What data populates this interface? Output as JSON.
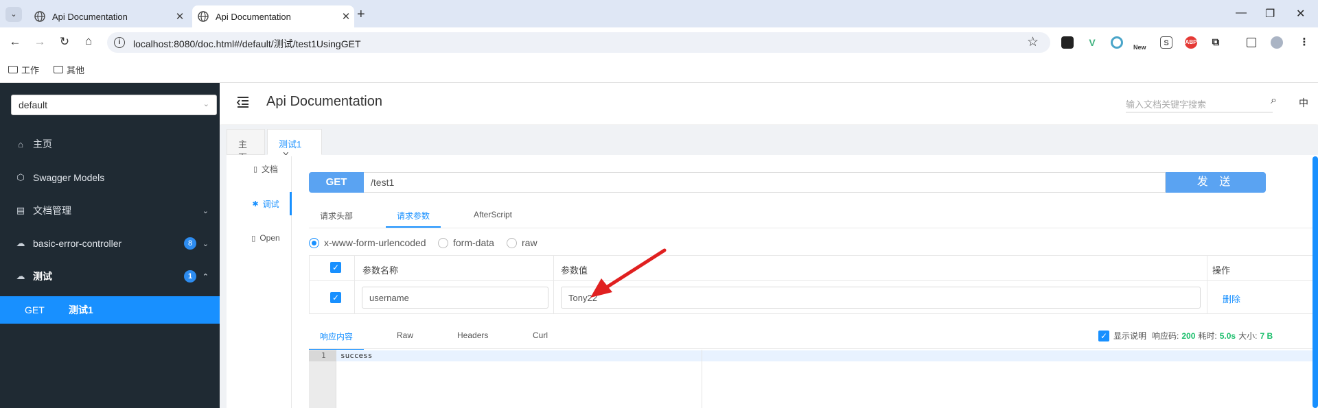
{
  "browser": {
    "tabs": [
      {
        "label": "Api Documentation",
        "active": false
      },
      {
        "label": "Api Documentation",
        "active": true
      }
    ],
    "url": "localhost:8080/doc.html#/default/测试/test1UsingGET",
    "bookmarks": [
      "工作",
      "其他"
    ],
    "extensions": [
      {
        "name": "shopping-bag-icon",
        "text": "",
        "color": "#222222"
      },
      {
        "name": "vue-devtools-icon",
        "text": "V",
        "color": "#3fb27f"
      },
      {
        "name": "circle-extension-icon",
        "text": "",
        "color": "#4aa5c9"
      },
      {
        "name": "new-extension-icon",
        "text": "New",
        "color": "#333333"
      },
      {
        "name": "s-extension-icon",
        "text": "S",
        "color": "#555555"
      },
      {
        "name": "adblock-icon",
        "text": "ABP",
        "color": "#e53935"
      }
    ]
  },
  "sidebar": {
    "group_select": "default",
    "items": [
      {
        "label": "主页",
        "icon": "home-icon"
      },
      {
        "label": "Swagger Models",
        "icon": "cube-icon"
      },
      {
        "label": "文档管理",
        "icon": "doc-manage-icon"
      },
      {
        "label": "basic-error-controller",
        "icon": "cloud-icon",
        "badge": "8"
      },
      {
        "label": "测试",
        "icon": "cloud-icon",
        "badge": "1"
      }
    ],
    "sub_item": {
      "method": "GET",
      "name": "测试1"
    }
  },
  "header": {
    "title": "Api Documentation",
    "search_placeholder": "输入文档关键字搜索",
    "lang": "中"
  },
  "page_tabs": [
    {
      "label": "主页"
    },
    {
      "label": "测试1",
      "close": "X"
    }
  ],
  "side_tabs": [
    {
      "label": "文档"
    },
    {
      "label": "调试"
    },
    {
      "label": "Open"
    }
  ],
  "request": {
    "method": "GET",
    "path": "/test1",
    "send_label": "发 送"
  },
  "request_tabs": [
    "请求头部",
    "请求参数",
    "AfterScript"
  ],
  "body_types": [
    "x-www-form-urlencoded",
    "form-data",
    "raw"
  ],
  "params_table": {
    "headers": [
      "参数名称",
      "参数值",
      "操作"
    ],
    "rows": [
      {
        "name": "username",
        "value": "Tony22",
        "action": "删除"
      }
    ]
  },
  "response_tabs": [
    "响应内容",
    "Raw",
    "Headers",
    "Curl"
  ],
  "response_meta": {
    "show_desc": "显示说明",
    "code_label": "响应码:",
    "code": "200",
    "time_label": "耗时:",
    "time": "5.0s",
    "size_label": "大小:",
    "size": "7 B"
  },
  "editor": {
    "line": "1",
    "content": "success"
  },
  "colors": {
    "accent": "#1890ff",
    "sidebar_bg": "#1f2a33",
    "success": "#19be6b",
    "annotation_arrow": "#e02020"
  }
}
